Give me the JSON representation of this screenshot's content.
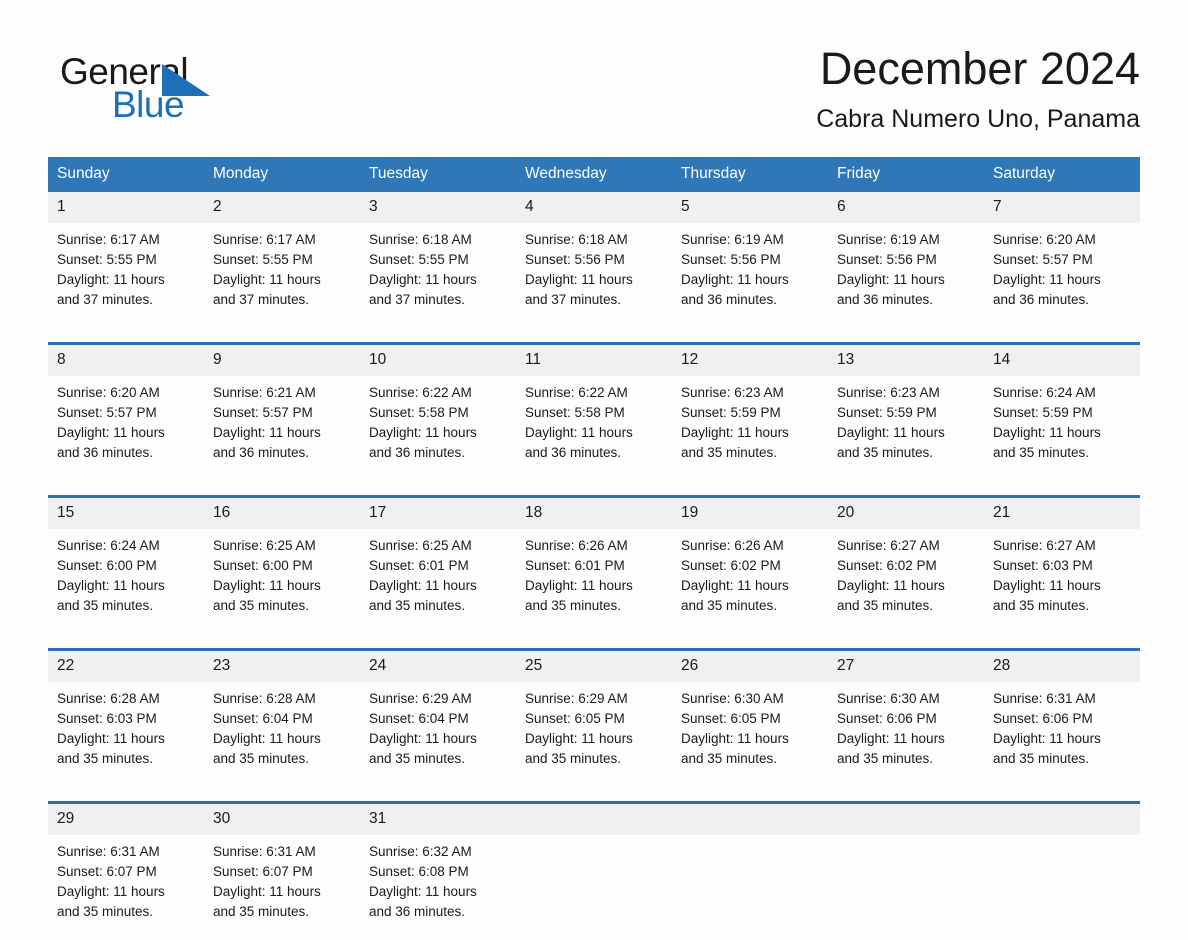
{
  "logo": {
    "word_one": "General",
    "word_two": "Blue",
    "triangle_icon": "triangle-icon",
    "brand_color": "#1d70b8"
  },
  "header": {
    "month_title": "December 2024",
    "location": "Cabra Numero Uno, Panama"
  },
  "calendar": {
    "header_color": "#3077b8",
    "row_divider_color": "#2d6fae",
    "daynum_band_color": "#f0f0f0",
    "weekdays": [
      "Sunday",
      "Monday",
      "Tuesday",
      "Wednesday",
      "Thursday",
      "Friday",
      "Saturday"
    ],
    "weeks": [
      [
        {
          "day": "1",
          "sunrise": "Sunrise: 6:17 AM",
          "sunset": "Sunset: 5:55 PM",
          "daylight_line1": "Daylight: 11 hours",
          "daylight_line2": "and 37 minutes."
        },
        {
          "day": "2",
          "sunrise": "Sunrise: 6:17 AM",
          "sunset": "Sunset: 5:55 PM",
          "daylight_line1": "Daylight: 11 hours",
          "daylight_line2": "and 37 minutes."
        },
        {
          "day": "3",
          "sunrise": "Sunrise: 6:18 AM",
          "sunset": "Sunset: 5:55 PM",
          "daylight_line1": "Daylight: 11 hours",
          "daylight_line2": "and 37 minutes."
        },
        {
          "day": "4",
          "sunrise": "Sunrise: 6:18 AM",
          "sunset": "Sunset: 5:56 PM",
          "daylight_line1": "Daylight: 11 hours",
          "daylight_line2": "and 37 minutes."
        },
        {
          "day": "5",
          "sunrise": "Sunrise: 6:19 AM",
          "sunset": "Sunset: 5:56 PM",
          "daylight_line1": "Daylight: 11 hours",
          "daylight_line2": "and 36 minutes."
        },
        {
          "day": "6",
          "sunrise": "Sunrise: 6:19 AM",
          "sunset": "Sunset: 5:56 PM",
          "daylight_line1": "Daylight: 11 hours",
          "daylight_line2": "and 36 minutes."
        },
        {
          "day": "7",
          "sunrise": "Sunrise: 6:20 AM",
          "sunset": "Sunset: 5:57 PM",
          "daylight_line1": "Daylight: 11 hours",
          "daylight_line2": "and 36 minutes."
        }
      ],
      [
        {
          "day": "8",
          "sunrise": "Sunrise: 6:20 AM",
          "sunset": "Sunset: 5:57 PM",
          "daylight_line1": "Daylight: 11 hours",
          "daylight_line2": "and 36 minutes."
        },
        {
          "day": "9",
          "sunrise": "Sunrise: 6:21 AM",
          "sunset": "Sunset: 5:57 PM",
          "daylight_line1": "Daylight: 11 hours",
          "daylight_line2": "and 36 minutes."
        },
        {
          "day": "10",
          "sunrise": "Sunrise: 6:22 AM",
          "sunset": "Sunset: 5:58 PM",
          "daylight_line1": "Daylight: 11 hours",
          "daylight_line2": "and 36 minutes."
        },
        {
          "day": "11",
          "sunrise": "Sunrise: 6:22 AM",
          "sunset": "Sunset: 5:58 PM",
          "daylight_line1": "Daylight: 11 hours",
          "daylight_line2": "and 36 minutes."
        },
        {
          "day": "12",
          "sunrise": "Sunrise: 6:23 AM",
          "sunset": "Sunset: 5:59 PM",
          "daylight_line1": "Daylight: 11 hours",
          "daylight_line2": "and 35 minutes."
        },
        {
          "day": "13",
          "sunrise": "Sunrise: 6:23 AM",
          "sunset": "Sunset: 5:59 PM",
          "daylight_line1": "Daylight: 11 hours",
          "daylight_line2": "and 35 minutes."
        },
        {
          "day": "14",
          "sunrise": "Sunrise: 6:24 AM",
          "sunset": "Sunset: 5:59 PM",
          "daylight_line1": "Daylight: 11 hours",
          "daylight_line2": "and 35 minutes."
        }
      ],
      [
        {
          "day": "15",
          "sunrise": "Sunrise: 6:24 AM",
          "sunset": "Sunset: 6:00 PM",
          "daylight_line1": "Daylight: 11 hours",
          "daylight_line2": "and 35 minutes."
        },
        {
          "day": "16",
          "sunrise": "Sunrise: 6:25 AM",
          "sunset": "Sunset: 6:00 PM",
          "daylight_line1": "Daylight: 11 hours",
          "daylight_line2": "and 35 minutes."
        },
        {
          "day": "17",
          "sunrise": "Sunrise: 6:25 AM",
          "sunset": "Sunset: 6:01 PM",
          "daylight_line1": "Daylight: 11 hours",
          "daylight_line2": "and 35 minutes."
        },
        {
          "day": "18",
          "sunrise": "Sunrise: 6:26 AM",
          "sunset": "Sunset: 6:01 PM",
          "daylight_line1": "Daylight: 11 hours",
          "daylight_line2": "and 35 minutes."
        },
        {
          "day": "19",
          "sunrise": "Sunrise: 6:26 AM",
          "sunset": "Sunset: 6:02 PM",
          "daylight_line1": "Daylight: 11 hours",
          "daylight_line2": "and 35 minutes."
        },
        {
          "day": "20",
          "sunrise": "Sunrise: 6:27 AM",
          "sunset": "Sunset: 6:02 PM",
          "daylight_line1": "Daylight: 11 hours",
          "daylight_line2": "and 35 minutes."
        },
        {
          "day": "21",
          "sunrise": "Sunrise: 6:27 AM",
          "sunset": "Sunset: 6:03 PM",
          "daylight_line1": "Daylight: 11 hours",
          "daylight_line2": "and 35 minutes."
        }
      ],
      [
        {
          "day": "22",
          "sunrise": "Sunrise: 6:28 AM",
          "sunset": "Sunset: 6:03 PM",
          "daylight_line1": "Daylight: 11 hours",
          "daylight_line2": "and 35 minutes."
        },
        {
          "day": "23",
          "sunrise": "Sunrise: 6:28 AM",
          "sunset": "Sunset: 6:04 PM",
          "daylight_line1": "Daylight: 11 hours",
          "daylight_line2": "and 35 minutes."
        },
        {
          "day": "24",
          "sunrise": "Sunrise: 6:29 AM",
          "sunset": "Sunset: 6:04 PM",
          "daylight_line1": "Daylight: 11 hours",
          "daylight_line2": "and 35 minutes."
        },
        {
          "day": "25",
          "sunrise": "Sunrise: 6:29 AM",
          "sunset": "Sunset: 6:05 PM",
          "daylight_line1": "Daylight: 11 hours",
          "daylight_line2": "and 35 minutes."
        },
        {
          "day": "26",
          "sunrise": "Sunrise: 6:30 AM",
          "sunset": "Sunset: 6:05 PM",
          "daylight_line1": "Daylight: 11 hours",
          "daylight_line2": "and 35 minutes."
        },
        {
          "day": "27",
          "sunrise": "Sunrise: 6:30 AM",
          "sunset": "Sunset: 6:06 PM",
          "daylight_line1": "Daylight: 11 hours",
          "daylight_line2": "and 35 minutes."
        },
        {
          "day": "28",
          "sunrise": "Sunrise: 6:31 AM",
          "sunset": "Sunset: 6:06 PM",
          "daylight_line1": "Daylight: 11 hours",
          "daylight_line2": "and 35 minutes."
        }
      ],
      [
        {
          "day": "29",
          "sunrise": "Sunrise: 6:31 AM",
          "sunset": "Sunset: 6:07 PM",
          "daylight_line1": "Daylight: 11 hours",
          "daylight_line2": "and 35 minutes."
        },
        {
          "day": "30",
          "sunrise": "Sunrise: 6:31 AM",
          "sunset": "Sunset: 6:07 PM",
          "daylight_line1": "Daylight: 11 hours",
          "daylight_line2": "and 35 minutes."
        },
        {
          "day": "31",
          "sunrise": "Sunrise: 6:32 AM",
          "sunset": "Sunset: 6:08 PM",
          "daylight_line1": "Daylight: 11 hours",
          "daylight_line2": "and 36 minutes."
        },
        {
          "day": "",
          "sunrise": "",
          "sunset": "",
          "daylight_line1": "",
          "daylight_line2": ""
        },
        {
          "day": "",
          "sunrise": "",
          "sunset": "",
          "daylight_line1": "",
          "daylight_line2": ""
        },
        {
          "day": "",
          "sunrise": "",
          "sunset": "",
          "daylight_line1": "",
          "daylight_line2": ""
        },
        {
          "day": "",
          "sunrise": "",
          "sunset": "",
          "daylight_line1": "",
          "daylight_line2": ""
        }
      ]
    ]
  }
}
